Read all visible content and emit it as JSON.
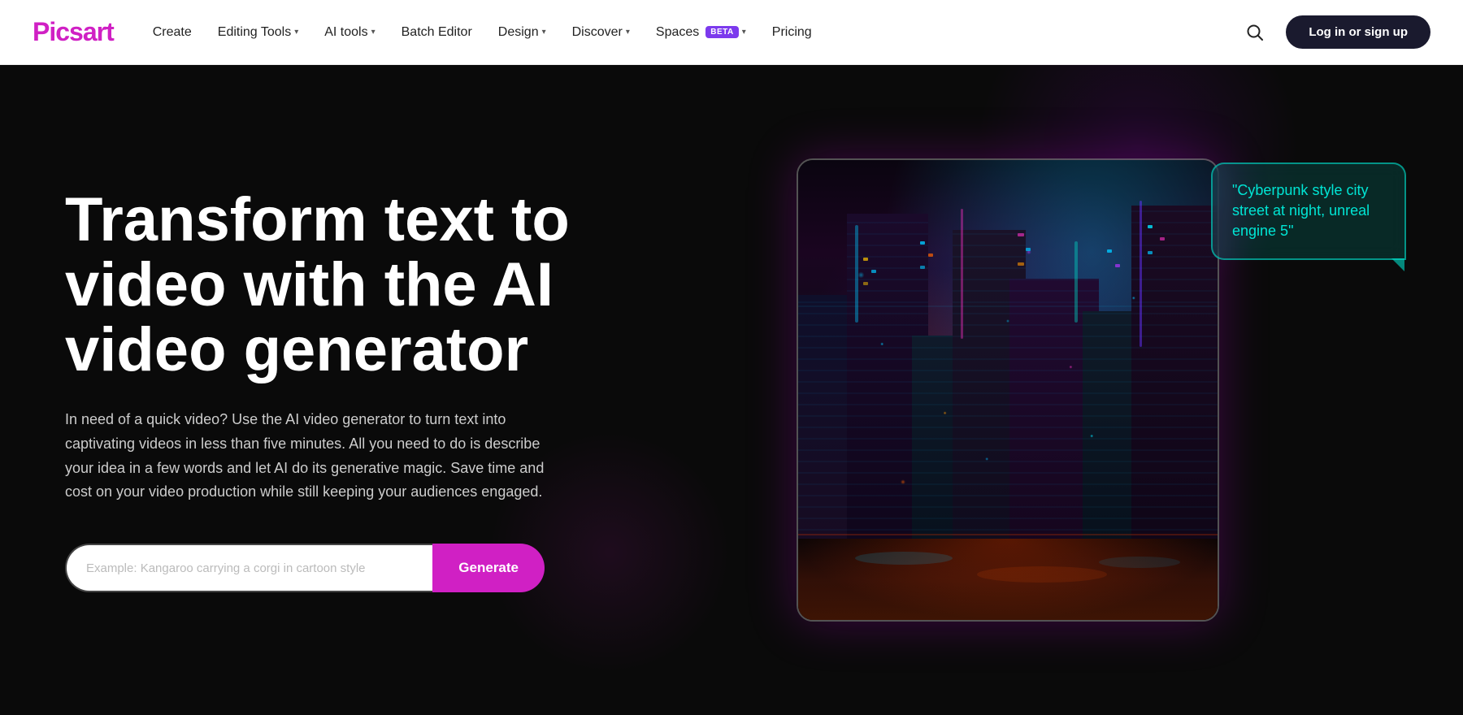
{
  "logo": {
    "text": "Picsart"
  },
  "navbar": {
    "create": "Create",
    "editing_tools": "Editing Tools",
    "ai_tools": "AI tools",
    "batch_editor": "Batch Editor",
    "design": "Design",
    "discover": "Discover",
    "spaces": "Spaces",
    "spaces_badge": "BETA",
    "pricing": "Pricing",
    "login_label": "Log in or sign up"
  },
  "hero": {
    "title": "Transform text to video with the AI video generator",
    "subtitle": "In need of a quick video? Use the AI video generator to turn text into captivating videos in less than five minutes. All you need to do is describe your idea in a few words and let AI do its generative magic. Save time and cost on your video production while still keeping your audiences engaged.",
    "input_placeholder": "Example: Kangaroo carrying a corgi in cartoon style",
    "generate_label": "Generate"
  },
  "prompt_bubble": {
    "text": "\"Cyberpunk style city street at night, unreal engine 5\""
  }
}
